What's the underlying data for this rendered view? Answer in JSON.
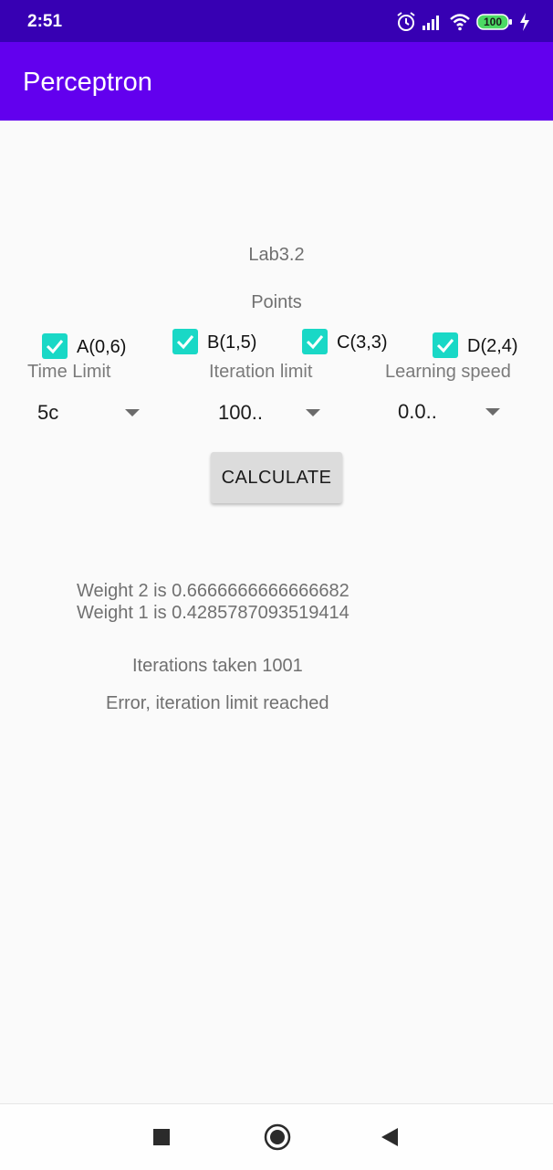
{
  "status_bar": {
    "time": "2:51",
    "battery": "100",
    "icons": [
      "alarm-icon",
      "signal-icon",
      "wifi-icon",
      "battery-icon",
      "charging-icon"
    ]
  },
  "app_bar": {
    "title": "Perceptron"
  },
  "main": {
    "lab_title": "Lab3.2",
    "points_label": "Points",
    "points": [
      {
        "label": "A(0,6)",
        "checked": true
      },
      {
        "label": "B(1,5)",
        "checked": true
      },
      {
        "label": "C(3,3)",
        "checked": true
      },
      {
        "label": "D(2,4)",
        "checked": true
      }
    ],
    "spinners": [
      {
        "caption": "Time Limit",
        "value": "5c"
      },
      {
        "caption": "Iteration limit",
        "value": "100.."
      },
      {
        "caption": "Learning speed",
        "value": "0.0.."
      }
    ],
    "calculate_label": "CALCULATE",
    "weight2": "Weight 2 is 0.6666666666666682",
    "weight1": "Weight 1 is 0.4285787093519414",
    "iterations": "Iterations taken 1001",
    "error": "Error, iteration limit reached"
  },
  "colors": {
    "status_bar": "#3700b3",
    "app_bar": "#6200ee",
    "checkbox": "#19d8c6",
    "background": "#fafafa"
  },
  "nav_bar": {
    "icons": [
      "square-icon",
      "home-circle-icon",
      "back-triangle-icon"
    ]
  }
}
